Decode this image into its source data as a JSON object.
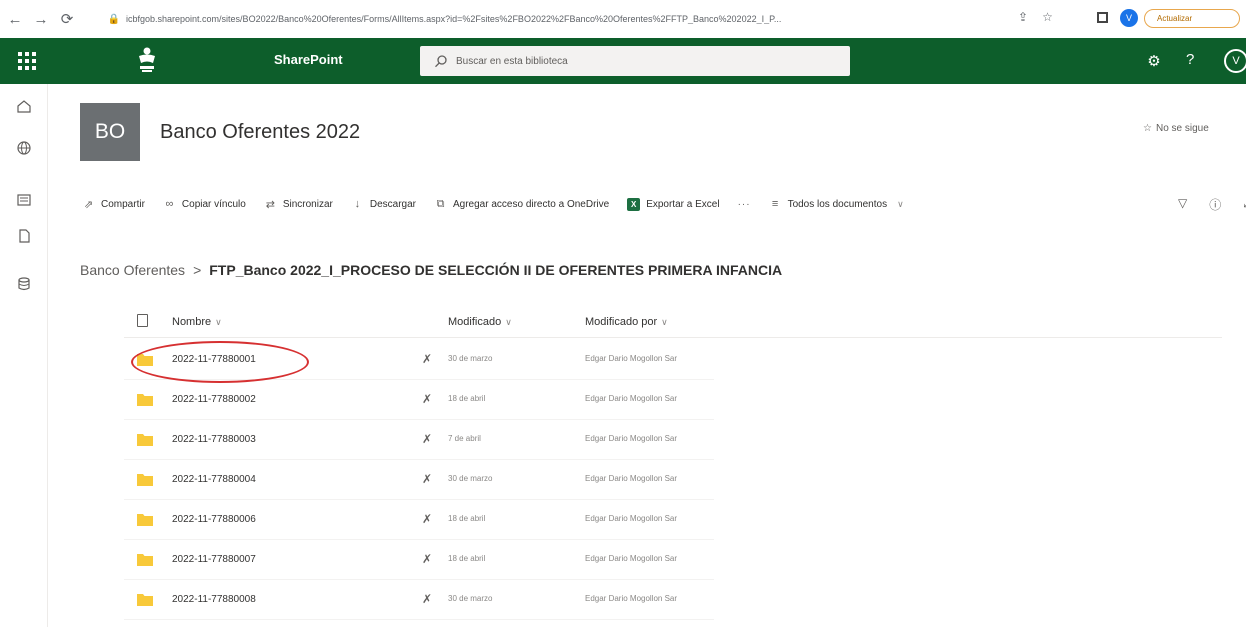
{
  "browser": {
    "url": "icbfgob.sharepoint.com/sites/BO2022/Banco%20Oferentes/Forms/AllItems.aspx?id=%2Fsites%2FBO2022%2FBanco%20Oferentes%2FFTP_Banco%202022_I_P...",
    "profile_initial": "V",
    "update_label": "Actualizar"
  },
  "suitebar": {
    "brand": "SharePoint",
    "search_placeholder": "Buscar en esta biblioteca",
    "user_initial": "V",
    "bg_color": "#0d5e2b"
  },
  "site": {
    "logo_text": "BO",
    "title": "Banco Oferentes 2022",
    "follow_label": "No se sigue"
  },
  "commandbar": {
    "share": "Compartir",
    "copy_link": "Copiar vínculo",
    "sync": "Sincronizar",
    "download": "Descargar",
    "add_shortcut": "Agregar acceso directo a OneDrive",
    "export_excel": "Exportar a Excel",
    "more": "···",
    "view": "Todos los documentos"
  },
  "breadcrumb": {
    "parent": "Banco Oferentes",
    "separator": ">",
    "current": "FTP_Banco 2022_I_PROCESO DE SELECCIÓN II DE OFERENTES PRIMERA INFANCIA"
  },
  "list": {
    "columns": {
      "name": "Nombre",
      "modified": "Modificado",
      "modified_by": "Modificado por"
    },
    "rows": [
      {
        "name": "2022-11-77880001",
        "modified": "30 de marzo",
        "modified_by": "Edgar Dario Mogollon Sar"
      },
      {
        "name": "2022-11-77880002",
        "modified": "18 de abril",
        "modified_by": "Edgar Dario Mogollon Sar"
      },
      {
        "name": "2022-11-77880003",
        "modified": "7 de abril",
        "modified_by": "Edgar Dario Mogollon Sar"
      },
      {
        "name": "2022-11-77880004",
        "modified": "30 de marzo",
        "modified_by": "Edgar Dario Mogollon Sar"
      },
      {
        "name": "2022-11-77880006",
        "modified": "18 de abril",
        "modified_by": "Edgar Dario Mogollon Sar"
      },
      {
        "name": "2022-11-77880007",
        "modified": "18 de abril",
        "modified_by": "Edgar Dario Mogollon Sar"
      },
      {
        "name": "2022-11-77880008",
        "modified": "30 de marzo",
        "modified_by": "Edgar Dario Mogollon Sar"
      }
    ]
  },
  "colors": {
    "folder": "#f8c93a",
    "highlight": "#d63031",
    "excel": "#1d6f42"
  }
}
